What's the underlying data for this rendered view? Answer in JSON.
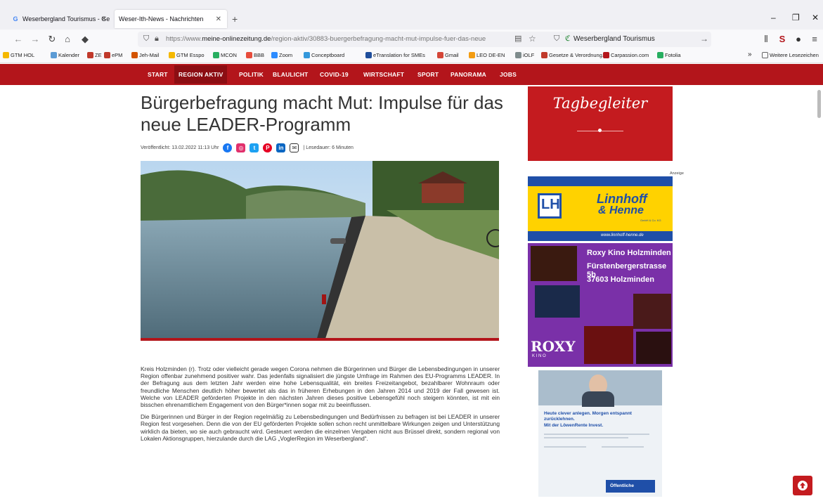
{
  "browser": {
    "tabs": [
      {
        "title": "Weserbergland Tourismus - Ge",
        "active": false
      },
      {
        "title": "Weser-Ith-News - Nachrichten",
        "active": true
      }
    ],
    "new_tab": "+",
    "window_controls": {
      "minimize": "–",
      "maximize": "❐",
      "close": "✕"
    },
    "url_host_prefix": "https://www.",
    "url_host": "meine-onlinezeitung.de",
    "url_path": "/region-aktiv/30883-buergerbefragung-macht-mut-impulse-fuer-das-neue",
    "search_engine_label": "Weserbergland Tourismus",
    "bookmarks": [
      "GTM HOL",
      "Kalender",
      "ZE",
      "ePM",
      "Jeh-Mail",
      "GTM Esspo",
      "MCON",
      "BBB",
      "Zoom",
      "Conceptboard",
      "eTranslation for SMEs",
      "Gmail",
      "LEO DE-EN",
      "iOLF",
      "Gesetze & Verordnung...",
      "Carpassion.com",
      "Fotolia"
    ],
    "other_bookmarks": "Weitere Lesezeichen",
    "bookmarks_overflow": "»"
  },
  "site_nav": [
    "START",
    "REGION AKTIV",
    "POLITIK",
    "BLAULICHT",
    "COVID-19",
    "WIRTSCHAFT",
    "SPORT",
    "PANORAMA",
    "JOBS"
  ],
  "article": {
    "title": "Bürgerbefragung macht Mut: Impulse für das neue LEADER-Programm",
    "published": "Veröffentlicht: 13.02.2022 11:13 Uhr",
    "reading_time": "| Lesedauer: 6 Minuten",
    "share_icons": [
      "facebook-icon",
      "instagram-icon",
      "twitter-icon",
      "pinterest-icon",
      "linkedin-icon",
      "mail-icon"
    ],
    "paragraphs": [
      "Kreis Holzminden (r). Trotz oder vielleicht gerade wegen Corona nehmen die Bürgerinnen und Bürger die Lebensbedingungen in unserer Region offenbar zunehmend positiver wahr. Das jedenfalls signalisiert die jüngste Umfrage im Rahmen des EU-Programms LEADER. In der Befragung aus dem letzten Jahr werden eine hohe Lebensqualität, ein breites Freizeitangebot, bezahlbarer Wohnraum oder freundliche Menschen deutlich höher bewertet als das in früheren Erhebungen in den Jahren 2014 und 2019 der Fall gewesen ist. Welche von LEADER geförderten Projekte in den nächsten Jahren dieses positive Lebensgefühl noch steigern könnten, ist mit ein bisschen ehrenamtlichem Engagement von den Bürger*innen sogar mit zu beeinflussen.",
      "Die Bürgerinnen und Bürger in der Region regelmäßig zu Lebensbedingungen und Bedürfnissen zu befragen ist bei LEADER in unserer Region fest vorgesehen. Denn die von der EU geförderten Projekte sollen schon recht unmittelbare Wirkungen zeigen und Unterstützung wirklich da bieten, wo sie auch gebraucht wird. Gesteuert werden die einzelnen Vergaben nicht aus Brüssel direkt, sondern regional von Lokalen Aktionsgruppen, hierzulande durch die LAG „VoglerRegion im Weserbergland“."
    ]
  },
  "sidebar": {
    "tagbegleiter_logo": "Tagbegleiter",
    "ad_label": "Anzeige",
    "linnhoff": {
      "name": "Linnhoff",
      "name2": "& Henne",
      "suffix": "GmbH & Co. KG",
      "url": "www.linnhoff-henne.de"
    },
    "roxy": {
      "line1": "Roxy Kino Holzminden",
      "line2": "Fürstenbergerstrasse 5b",
      "line3": "37603 Holzminden",
      "logo": "ROXY",
      "logo_sub": "K I N O"
    },
    "lowen": {
      "headline1": "Heute clever anlegen. Morgen entspannt",
      "headline2": "zurücklehnen.",
      "headline3": "Mit der LöwenRente Invest.",
      "brand": "Öffentliche"
    }
  },
  "colors": {
    "brand_red": "#b3151b",
    "ad_yellow": "#ffd200",
    "roxy_purple": "#7a30a8"
  }
}
